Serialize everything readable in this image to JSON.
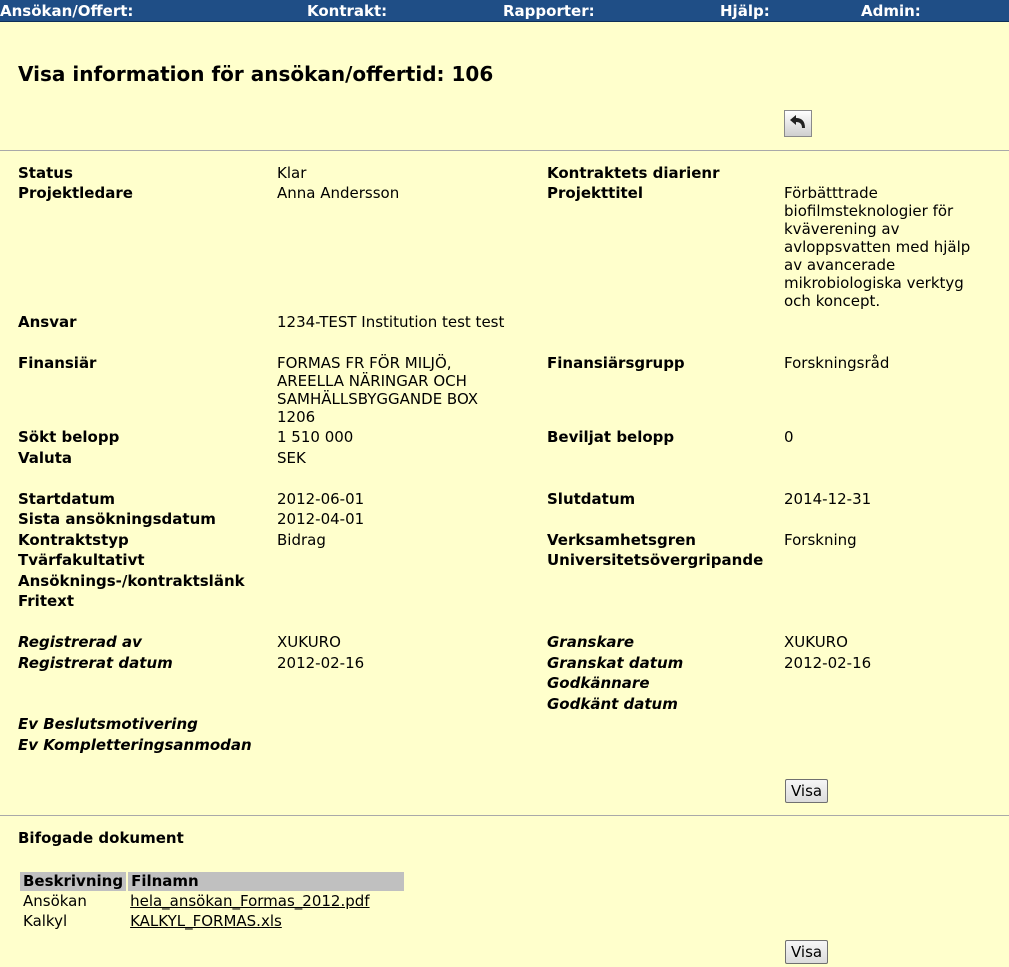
{
  "nav": {
    "applications": "Ansökan/Offert:",
    "contracts": "Kontrakt:",
    "reports": "Rapporter:",
    "help": "Hjälp:",
    "admin": "Admin:"
  },
  "page": {
    "title": "Visa information för ansökan/offertid: 106"
  },
  "fields": {
    "status_label": "Status",
    "status_value": "Klar",
    "diary_label": "Kontraktets diarienr",
    "project_leader_label": "Projektledare",
    "project_leader_value": "Anna Andersson",
    "project_title_label": "Projekttitel",
    "project_title_value": "Förbätttrade biofilmsteknologier för kväverening av avloppsvatten med hjälp av avancerade mikrobiologiska verktyg och koncept.",
    "responsible_label": "Ansvar",
    "responsible_value": "1234-TEST Institution test test",
    "financier_label": "Finansiär",
    "financier_value": "FORMAS FR FÖR MILJÖ, AREELLA NÄRINGAR OCH SAMHÄLLSBYGGANDE BOX 1206",
    "financier_group_label": "Finansiärsgrupp",
    "financier_group_value": "Forskningsråd",
    "requested_label": "Sökt belopp",
    "requested_value": "1 510 000",
    "granted_label": "Beviljat belopp",
    "granted_value": "0",
    "currency_label": "Valuta",
    "currency_value": "SEK",
    "start_label": "Startdatum",
    "start_value": "2012-06-01",
    "end_label": "Slutdatum",
    "end_value": "2014-12-31",
    "deadline_label": "Sista ansökningsdatum",
    "deadline_value": "2012-04-01",
    "contract_type_label": "Kontraktstyp",
    "contract_type_value": "Bidrag",
    "activity_label": "Verksamhetsgren",
    "activity_value": "Forskning",
    "interfaculty_label": "Tvärfakultativt",
    "university_wide_label": "Universitetsövergripande",
    "link_label": "Ansöknings-/kontraktslänk",
    "freetext_label": "Fritext",
    "registered_by_label": "Registrerad av",
    "registered_by_value": "XUKURO",
    "reviewer_label": "Granskare",
    "reviewer_value": "XUKURO",
    "registered_date_label": "Registrerat datum",
    "registered_date_value": "2012-02-16",
    "reviewed_date_label": "Granskat datum",
    "reviewed_date_value": "2012-02-16",
    "approver_label": "Godkännare",
    "approved_date_label": "Godkänt datum",
    "decision_label": "Ev Beslutsmotivering",
    "completion_label": "Ev Kompletteringsanmodan"
  },
  "buttons": {
    "show_1": "Visa",
    "show_2": "Visa"
  },
  "attachments": {
    "heading": "Bifogade dokument",
    "columns": [
      "Beskrivning",
      "Filnamn"
    ],
    "rows": [
      {
        "description": "Ansökan",
        "filename": "hela_ansökan_Formas_2012.pdf"
      },
      {
        "description": "Kalkyl",
        "filename": "KALKYL_FORMAS.xls"
      }
    ]
  },
  "icons": {
    "back": "undo-arrow-icon"
  }
}
